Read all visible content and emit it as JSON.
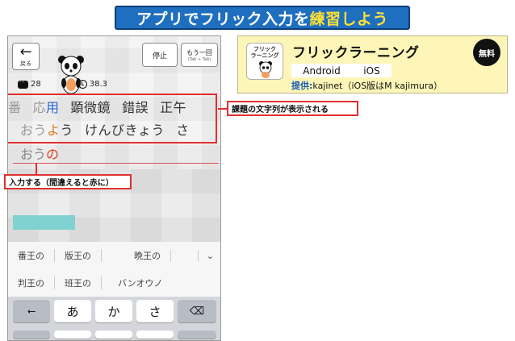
{
  "banner": {
    "title_part1": "アプリでフリック入力を",
    "title_highlight": "練習しよう",
    "colors": {
      "background": "#1f6fc0",
      "text": "#ffffff",
      "highlight": "#ffe033"
    }
  },
  "phone": {
    "back_button": {
      "icon": "left-arrow-icon",
      "label": "戻る"
    },
    "stop_button": {
      "label": "停止"
    },
    "again_button": {
      "label": "もう一回",
      "sublabel": "(Tab + Tab)"
    },
    "stats": {
      "count_icon": "chat-bubble-icon",
      "count": "28",
      "timer_icon": "clock-icon",
      "time": "38.3"
    },
    "kanji_words": [
      {
        "text": "番",
        "state": "done"
      },
      {
        "text": "応",
        "state": "done"
      },
      {
        "text": "用",
        "state": "current"
      },
      {
        "text": "顕微鏡",
        "state": "upcoming"
      },
      {
        "text": "錯誤",
        "state": "upcoming"
      },
      {
        "text": "正午",
        "state": "upcoming"
      }
    ],
    "kana_done": "おう",
    "kana_current": "よ",
    "kana_rest": "う",
    "kana_next": "けんびきょう",
    "kana_cut": "さ",
    "typed_correct": "おう",
    "typed_error": "の",
    "candidates": {
      "row1": [
        "番王の",
        "版王の",
        "晩王の"
      ],
      "row2": [
        "判王の",
        "班王の",
        "バンオウノ"
      ],
      "expand_icon": "chevron-down-icon"
    },
    "keyboard": {
      "left_key_icon": "undo-arrow-icon",
      "keys": [
        "あ",
        "か",
        "さ"
      ],
      "delete_icon": "delete-icon"
    }
  },
  "callouts": {
    "problem": "課題の文字列が表示される",
    "input": "入力する（間違えると赤に）"
  },
  "app_card": {
    "icon_text_line1": "フリック",
    "icon_text_line2": "ラーニング",
    "name": "フリックラーニング",
    "badge": "無料",
    "platform_android": "Android",
    "platform_ios": "iOS",
    "provider_label": "提供:",
    "provider_value": "kajinet（iOS版はM kajimura）",
    "background": "#fdf6b8"
  }
}
